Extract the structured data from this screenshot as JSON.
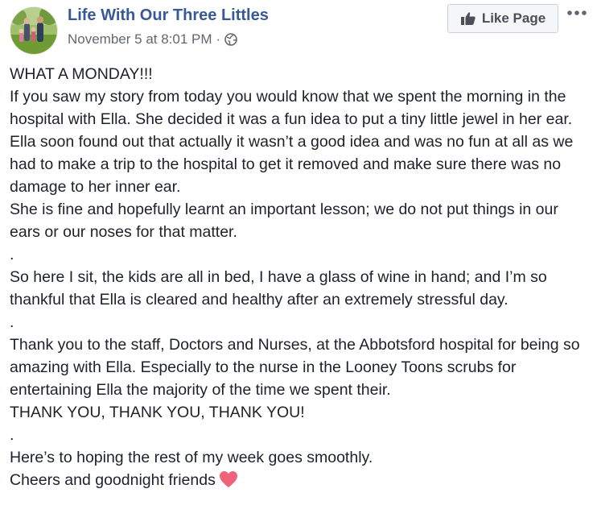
{
  "header": {
    "page_name": "Life With Our Three Littles",
    "timestamp": "November 5 at 8:01 PM",
    "separator": "·",
    "privacy_icon": "globe-icon",
    "avatar_icon": "family-photo-avatar"
  },
  "actions": {
    "like_page_label": "Like Page",
    "like_icon": "thumbs-up-icon",
    "more_icon": "more-options-icon"
  },
  "post": {
    "lines": [
      "WHAT A MONDAY!!!",
      "If you saw my story from today you would know that we spent the morning in the hospital with Ella. She decided it was a fun idea to put a tiny little jewel in her ear.",
      "Ella soon found out that actually it wasn’t a good idea and was no fun at all as we had to make a trip to the hospital to get it removed and make sure there was no damage to her inner ear.",
      "She is fine and hopefully learnt an important lesson; we do not put things in our ears or our noses for that matter.",
      ".",
      "So here I sit, the kids are all in bed, I have a glass of wine in hand; and I’m so thankful that Ella is cleared and healthy after an extremely stressful day.",
      ".",
      "Thank you to the staff, Doctors and Nurses, at the Abbotsford hospital for being so amazing with Ella. Especially to the nurse in the Looney Toons scrubs for entertaining Ella the majority of the time we spent their.",
      "THANK YOU, THANK YOU, THANK YOU!",
      ".",
      "Here’s to hoping the rest of my week goes smoothly.",
      "Cheers and goodnight friends"
    ],
    "closing_emoji": "heart-icon"
  },
  "colors": {
    "page_name": "#385898",
    "meta_text": "#616770",
    "body_text": "#1d2129",
    "heart": "#f0627a"
  }
}
